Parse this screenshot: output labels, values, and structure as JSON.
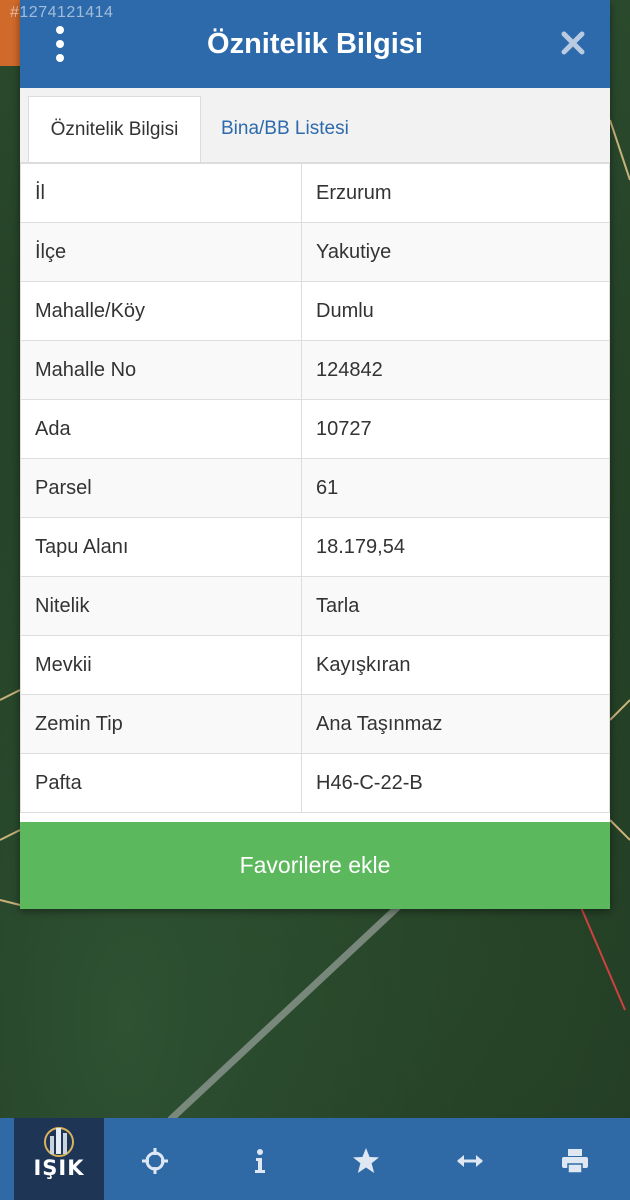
{
  "watermark": "#1274121414",
  "dialog": {
    "title": "Öznitelik Bilgisi",
    "menu_icon": "more-vertical-icon",
    "close_icon": "close-icon",
    "tabs": [
      {
        "label": "Öznitelik Bilgisi",
        "active": true
      },
      {
        "label": "Bina/BB Listesi",
        "active": false
      }
    ],
    "rows": [
      {
        "key": "İl",
        "value": "Erzurum"
      },
      {
        "key": "İlçe",
        "value": "Yakutiye"
      },
      {
        "key": "Mahalle/Köy",
        "value": "Dumlu"
      },
      {
        "key": "Mahalle No",
        "value": "124842"
      },
      {
        "key": "Ada",
        "value": "10727"
      },
      {
        "key": "Parsel",
        "value": "61"
      },
      {
        "key": "Tapu Alanı",
        "value": "18.179,54"
      },
      {
        "key": "Nitelik",
        "value": "Tarla"
      },
      {
        "key": "Mevkii",
        "value": "Kayışkıran"
      },
      {
        "key": "Zemin Tip",
        "value": "Ana Taşınmaz"
      },
      {
        "key": "Pafta",
        "value": "H46-C-22-B"
      }
    ],
    "favorite_button": "Favorilere ekle"
  },
  "bottom_bar": {
    "logo_text": "IŞIK",
    "icons": [
      "crosshair-icon",
      "info-icon",
      "star-icon",
      "measure-icon",
      "print-icon"
    ]
  },
  "colors": {
    "header": "#2d6aac",
    "tab_link": "#2d6aac",
    "button": "#5cb85c",
    "bottom_bar": "#2f6aa6"
  }
}
